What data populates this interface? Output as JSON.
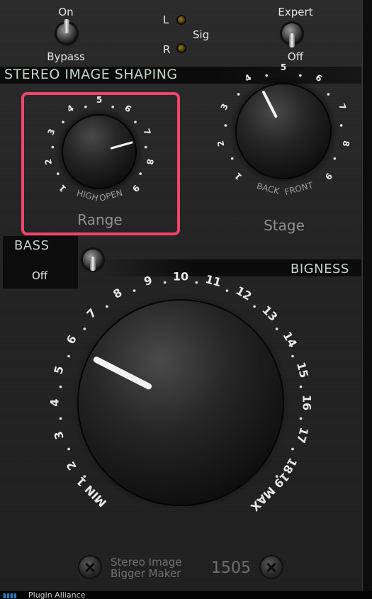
{
  "top": {
    "bypass_toggle_top": "On",
    "bypass_toggle_bottom": "Bypass",
    "sig_label": "Sig",
    "led_left": "L",
    "led_right": "R",
    "expert_toggle_top": "Expert",
    "expert_toggle_bottom": "Off"
  },
  "stereo_section": {
    "title": "STEREO IMAGE SHAPING",
    "range": {
      "label": "Range",
      "scale": [
        "1",
        "2",
        "3",
        "4",
        "5",
        "6",
        "7",
        "8",
        "9"
      ],
      "end_left": "HIGH",
      "end_right": "OPEN",
      "value": 7.2
    },
    "stage": {
      "label": "Stage",
      "scale": [
        "1",
        "2",
        "3",
        "4",
        "5",
        "6",
        "7",
        "8",
        "9"
      ],
      "end_left": "BACK",
      "end_right": "FRONT",
      "value": 4.2
    }
  },
  "bass": {
    "title": "BASS",
    "state": "Off"
  },
  "bigness": {
    "title": "BIGNESS",
    "scale": [
      "MIN 1",
      "2",
      "3",
      "4",
      "5",
      "6",
      "7",
      "8",
      "9",
      "10",
      "11",
      "12",
      "13",
      "14",
      "15",
      "16",
      "17",
      "18",
      "19 MAX"
    ],
    "value": 5.8
  },
  "brand": {
    "line1": "Stereo Image",
    "line2": "Bigger Maker",
    "model": "1505"
  },
  "colors": {
    "highlight": "#f0446b",
    "section_text": "#c3d6c9",
    "panel": "#242424"
  },
  "footer": {
    "text": "Plugin Alliance"
  }
}
